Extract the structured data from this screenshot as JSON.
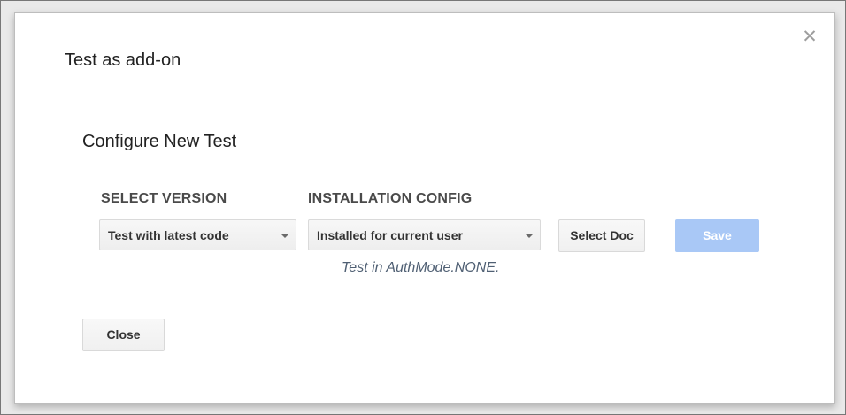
{
  "dialog": {
    "title": "Test as add-on",
    "close_icon_glyph": "✕"
  },
  "configure": {
    "heading": "Configure New Test",
    "version_label": "SELECT VERSION",
    "version_selected": "Test with latest code",
    "installation_label": "INSTALLATION CONFIG",
    "installation_selected": "Installed for current user",
    "select_doc_label": "Select Doc",
    "save_label": "Save",
    "save_enabled": false,
    "auth_hint": "Test in AuthMode.NONE."
  },
  "footer": {
    "close_label": "Close"
  },
  "colors": {
    "save_disabled_bg": "#a9c8f6",
    "hint_text": "#4f5f73"
  },
  "icons": {
    "close": "close-icon",
    "dropdown": "chevron-down-icon"
  }
}
